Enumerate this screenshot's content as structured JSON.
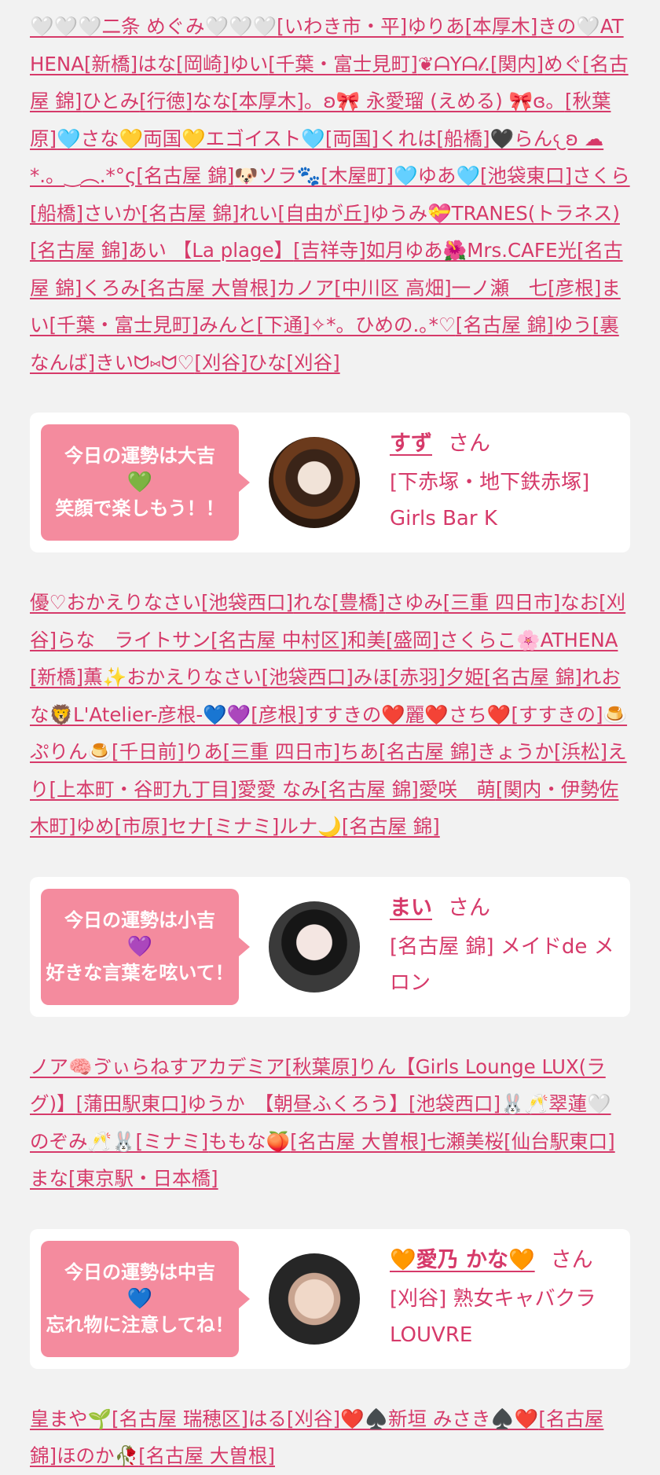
{
  "block1": [
    "🤍🤍🤍二条 めぐみ🤍🤍🤍",
    "[いわき市・平]",
    "ゆりあ",
    "[本厚木]",
    "きの🤍ATHENA",
    "[新橋]",
    "はな",
    "[岡崎]",
    "ゆい",
    "[千葉・富士見町]",
    "❦ᗩYᗩ𝓁.",
    "[関内]",
    "めぐ",
    "[名古屋 錦]",
    "ひとみ",
    "[行徳]",
    "なな",
    "[本厚木]",
    "。ʚ🎀 永愛瑠 (えめる) 🎀ɞ。",
    "[秋葉原]",
    "🩵さな💛両国💛エゴイスト🩵",
    "[両国]",
    "くれは",
    "[船橋]",
    "🖤らん𐔌ʚ ☁︎ *.。‿︵.*°ς",
    "[名古屋 錦]",
    "🐶ソラ🐾",
    "[木屋町]",
    "🩵ゆあ🩵",
    "[池袋東口]",
    "さくら",
    "[船橋]",
    "さいか",
    "[名古屋 錦]",
    "れい",
    "[自由が丘]",
    "ゆうみ💝TRANES(トラネス)",
    "[名古屋 錦]",
    "あい 【La plage】",
    "[吉祥寺]",
    "如月ゆあ🌺Mrs.CAFE光",
    "[名古屋 錦]",
    "くろみ",
    "[名古屋 大曽根]",
    "カノア",
    "[中川区 高畑]",
    "一ノ瀬　七",
    "[彦根]",
    "まい",
    "[千葉・富士見町]",
    "みんと",
    "[下通]",
    "✧*。ひめの.｡*♡",
    "[名古屋 錦]",
    "ゆう",
    "[裏なんば]",
    "きいᗢ⑅ᗢ♡",
    "[刈谷]",
    "ひな",
    "[刈谷]"
  ],
  "card1": {
    "fortune": "今日の運勢は大吉",
    "heart": "💚",
    "message": "笑顔で楽しもう！！",
    "name": "すず",
    "san": "さん",
    "shop": "[下赤塚・地下鉄赤塚] Girls Bar K"
  },
  "block2": [
    "優♡おかえりなさい",
    "[池袋西口]",
    "れな",
    "[豊橋]",
    "さゆみ",
    "[三重 四日市]",
    "なお",
    "[刈谷]",
    "らな　ライトサン",
    "[名古屋 中村区]",
    "和美",
    "[盛岡]",
    "さくらこ🌸ATHENA",
    "[新橋]",
    "薫✨おかえりなさい",
    "[池袋西口]",
    "みほ",
    "[赤羽]",
    "夕姫",
    "[名古屋 錦]",
    "れおな🦁L'Atelier-彦根-💙💜",
    "[彦根]",
    "すすきの❤️麗❤️さち❤️",
    "[すすきの]",
    "🍮ぷりん🍮",
    "[千日前]",
    "りあ",
    "[三重 四日市]",
    "ちあ",
    "[名古屋 錦]",
    "きょうか",
    "[浜松]",
    "えり",
    "[上本町・谷町九丁目]",
    "愛愛 なみ",
    "[名古屋 錦]",
    "愛咲　萌",
    "[関内・伊勢佐木町]",
    "ゆめ",
    "[市原]",
    "セナ",
    "[ミナミ]",
    "ルナ🌙",
    "[名古屋 錦]"
  ],
  "card2": {
    "fortune": "今日の運勢は小吉",
    "heart": "💜",
    "message": "好きな言葉を呟いて！",
    "name": "まい",
    "san": "さん",
    "shop": "[名古屋 錦] メイドde メロン"
  },
  "block3": [
    "ノア🧠ゔぃらねすアカデミア",
    "[秋葉原]",
    "りん【Girls Lounge LUX(ラグ)】",
    "[蒲田駅東口]",
    "ゆうか　【朝昼ふくろう】",
    "[池袋西口]",
    "🐰🥂翠蓮🤍のぞみ🥂🐰",
    "[ミナミ]",
    "ももな🍑",
    "[名古屋 大曽根]",
    "七瀬美桜",
    "[仙台駅東口]",
    "まな",
    "[東京駅・日本橋]"
  ],
  "card3": {
    "fortune": "今日の運勢は中吉",
    "heart": "💙",
    "message": "忘れ物に注意してね！",
    "name": "🧡愛乃 かな🧡",
    "san": "さん",
    "shop": "[刈谷] 熟女キャバクラLOUVRE"
  },
  "block4": [
    "皇まや🌱",
    "[名古屋 瑞穂区]",
    "はる",
    "[刈谷]",
    "❤️♠️新垣 みさき♠️❤️",
    "[名古屋 錦]",
    "ほのか🥀",
    "[名古屋 大曽根]"
  ]
}
